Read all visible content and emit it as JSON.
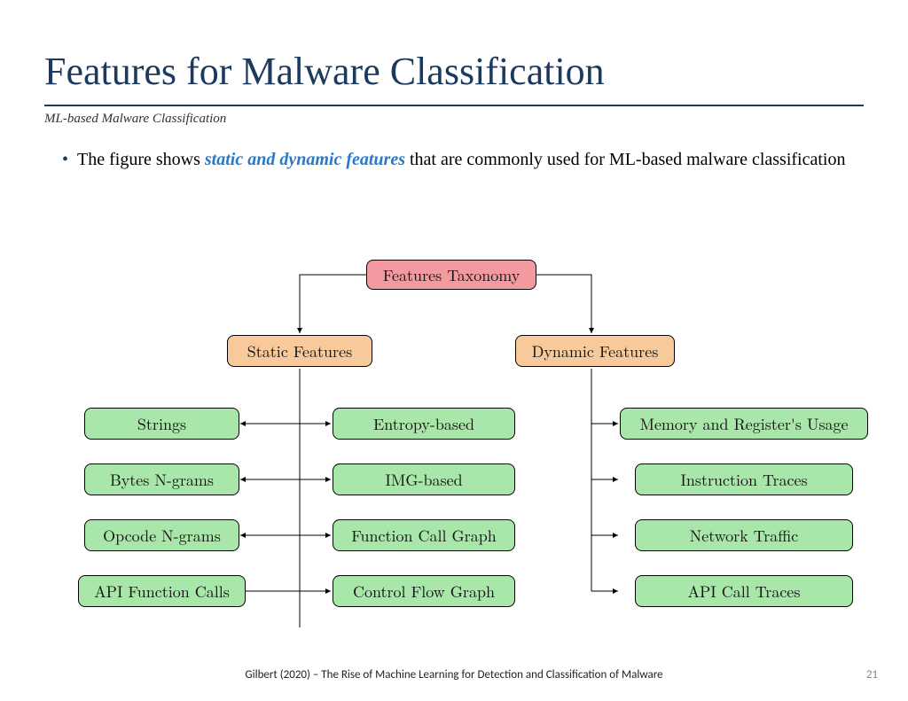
{
  "title": "Features for Malware Classification",
  "subtitle": "ML-based Malware Classification",
  "bullet": {
    "pre": "The figure shows ",
    "em": "static and dynamic features",
    "post": " that are commonly used for ML-based malware classification"
  },
  "diagram": {
    "root": "Features Taxonomy",
    "static": {
      "label": "Static Features",
      "left": [
        "Strings",
        "Bytes N-grams",
        "Opcode N-grams",
        "API Function Calls"
      ],
      "right": [
        "Entropy-based",
        "IMG-based",
        "Function Call Graph",
        "Control Flow Graph"
      ]
    },
    "dynamic": {
      "label": "Dynamic Features",
      "items": [
        "Memory and Register's Usage",
        "Instruction Traces",
        "Network Traffic",
        "API Call Traces"
      ]
    }
  },
  "footer": "Gilbert (2020) – The Rise of Machine Learning for Detection and Classification of Malware",
  "page": "21"
}
